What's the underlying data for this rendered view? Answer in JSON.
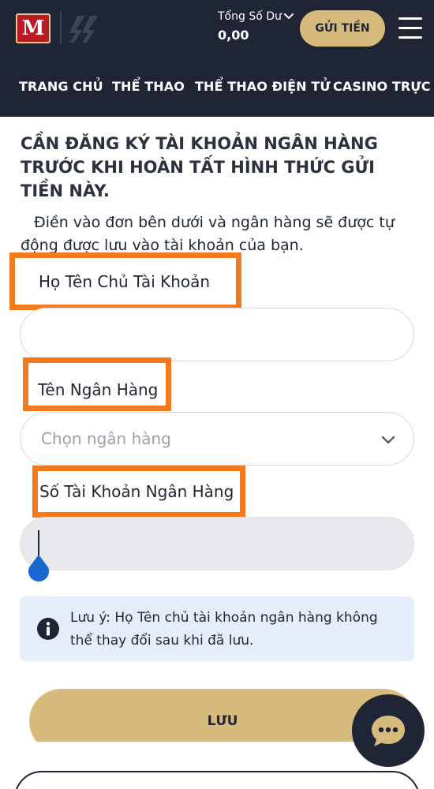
{
  "header": {
    "logo_letter": "M",
    "balance_label": "Tổng Số Dư",
    "balance_value": "0,00",
    "deposit_label": "GỬI TIỀN"
  },
  "nav": {
    "items": [
      {
        "label": "TRANG CHỦ"
      },
      {
        "label": "THỂ THAO"
      },
      {
        "label": "THỂ THAO ĐIỆN TỬ"
      },
      {
        "label": "CASINO TRỰC TUYẾN"
      }
    ]
  },
  "form": {
    "title": "CẦN ĐĂNG KÝ TÀI KHOẢN NGÂN HÀNG TRƯỚC KHI HOÀN TẤT HÌNH THỨC GỬI TIỀN NÀY.",
    "description": "Điền vào đơn bên dưới và ngân hàng sẽ được tự động được lưu vào tài khoản của bạn.",
    "account_name_label": "Họ Tên Chủ Tài Khoản",
    "account_name_value": "",
    "bank_label": "Tên Ngân Hàng",
    "bank_placeholder": "Chọn ngân hàng",
    "account_number_label": "Số Tài Khoản Ngân Hàng",
    "account_number_value": "",
    "note": "Lưu ý: Họ Tên chủ tài khoản ngân hàng không thể thay đổi sau khi đã lưu.",
    "save_label": "LƯU"
  },
  "colors": {
    "header_bg": "#1f2535",
    "accent_gold": "#d6bb7d",
    "highlight_orange": "#f47a20",
    "note_bg": "#e4eefb",
    "logo_red": "#b81c23"
  },
  "icons": {
    "balance_toggle": "chevron-down-icon",
    "menu": "hamburger-menu-icon",
    "select": "chevron-down-icon",
    "note": "info-icon",
    "chat": "chat-bubble-icon"
  }
}
